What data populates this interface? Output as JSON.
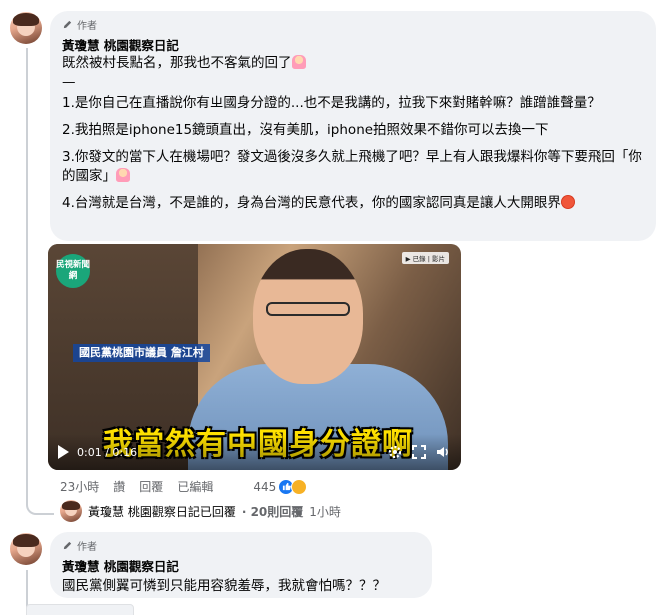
{
  "comment1": {
    "author_badge": "作者",
    "author_name": "黃瓊慧 桃園觀察日記",
    "lines": [
      "既然被村長點名，那我也不客氣的回了",
      "—",
      "1.是你自己在直播說你有ㄓ國身分證的...也不是我講的，拉我下來對賭幹嘛？誰蹭誰聲量？",
      "2.我拍照是iphone15鏡頭直出，沒有美肌，iphone拍照效果不錯你可以去換一下",
      "3.你發文的當下人在機場吧？發文過後沒多久就上飛機了吧？早上有人跟我爆料你等下要飛回「你的國家」",
      "4.台灣就是台灣，不是誰的，身為台灣的民意代表，你的國家認同真是讓人大開眼界"
    ]
  },
  "video": {
    "logo_text": "民視新聞網",
    "channel_tag": "▶ 已錄 | 影片",
    "lower_tag": "國民黨桃園市議員 詹江村",
    "caption": "我當然有中國身分證啊",
    "time": "0:01 / 0:16"
  },
  "actions": {
    "timestamp": "23小時",
    "like_label": "讚",
    "reply_label": "回覆",
    "edited_label": "已編輯",
    "reaction_count": "445"
  },
  "reply_summary": {
    "name": "黃瓊慧 桃園觀察日記已回覆",
    "count": "· 20則回覆",
    "time": "1小時"
  },
  "comment2": {
    "author_badge": "作者",
    "author_name": "黃瓊慧 桃園觀察日記",
    "text": "國民黨側翼可憐到只能用容貌羞辱，我就會怕嗎？？？"
  },
  "colors": {
    "bubble": "#f0f2f5",
    "like_blue": "#1877f2",
    "caption_yellow": "#ffe100"
  }
}
